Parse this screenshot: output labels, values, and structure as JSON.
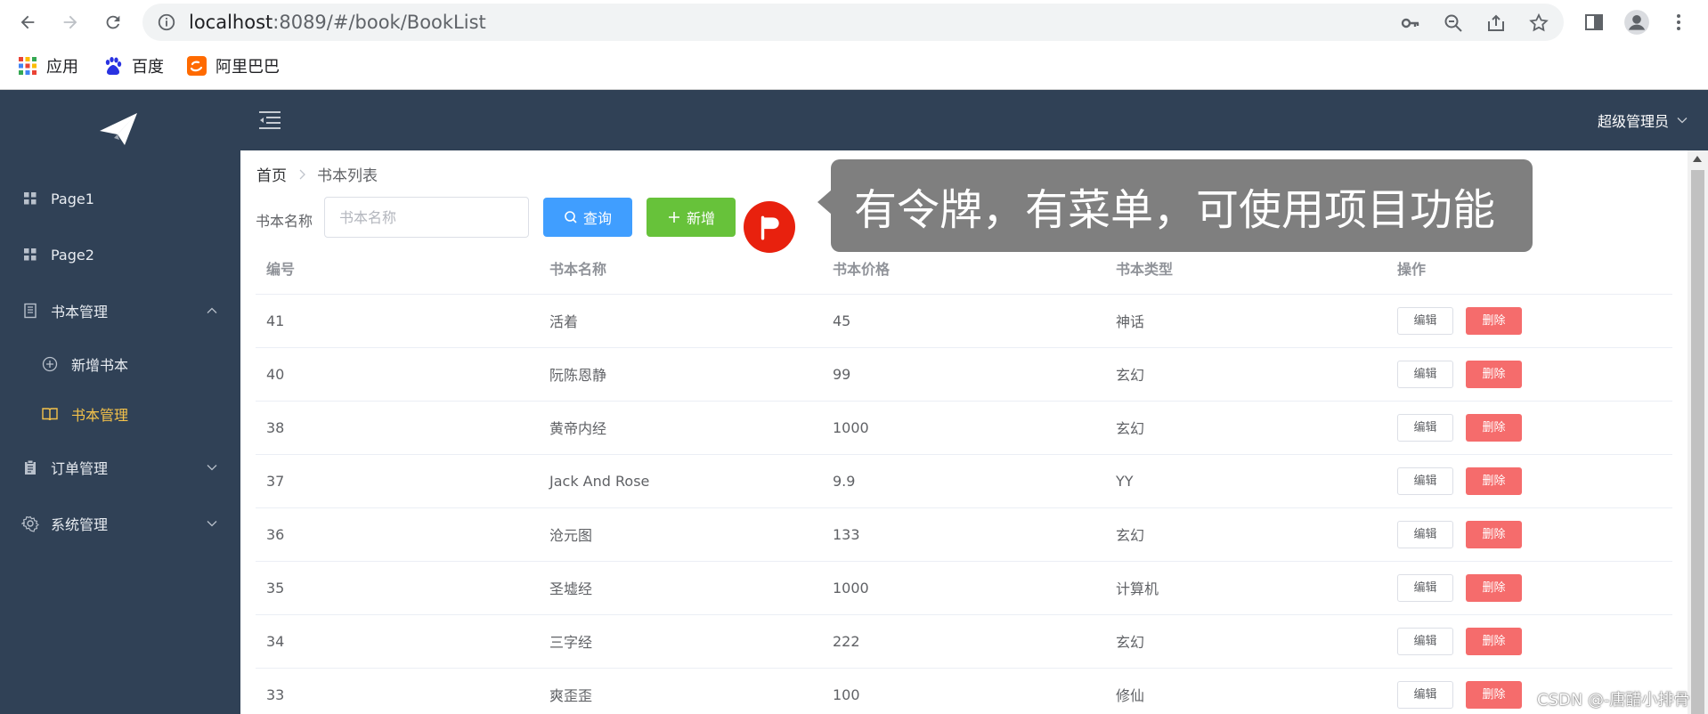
{
  "browser": {
    "url_host": "localhost",
    "url_rest": ":8089/#/book/BookList",
    "bookmarks": [
      {
        "label": "应用",
        "icon": "apps-grid-icon"
      },
      {
        "label": "百度",
        "icon": "baidu-icon"
      },
      {
        "label": "阿里巴巴",
        "icon": "alibaba-icon"
      }
    ]
  },
  "sidebar": {
    "logo": "paper-plane-icon",
    "items": [
      {
        "label": "Page1",
        "icon": "grid-icon"
      },
      {
        "label": "Page2",
        "icon": "grid-icon"
      },
      {
        "label": "书本管理",
        "icon": "document-icon",
        "expanded": true
      },
      {
        "label": "订单管理",
        "icon": "clipboard-icon",
        "expanded": false
      },
      {
        "label": "系统管理",
        "icon": "gear-icon",
        "expanded": false
      }
    ],
    "submenu": [
      {
        "label": "新增书本",
        "icon": "circle-plus-icon",
        "active": false
      },
      {
        "label": "书本管理",
        "icon": "book-icon",
        "active": true
      }
    ],
    "active_color": "#f4c24a",
    "background": "#304156"
  },
  "header": {
    "user": "超级管理员"
  },
  "breadcrumb": {
    "home": "首页",
    "current": "书本列表"
  },
  "search": {
    "label": "书本名称",
    "placeholder": "书本名称",
    "value": "",
    "query_label": "查询",
    "add_label": "新增"
  },
  "tooltip": {
    "text": "有令牌，有菜单，可使用项目功能"
  },
  "table": {
    "headers": [
      "编号",
      "书本名称",
      "书本价格",
      "书本类型",
      "操作"
    ],
    "edit_label": "编辑",
    "delete_label": "删除",
    "rows": [
      {
        "id": "41",
        "name": "活着",
        "price": "45",
        "type": "神话"
      },
      {
        "id": "40",
        "name": "阮陈恩静",
        "price": "99",
        "type": "玄幻"
      },
      {
        "id": "38",
        "name": "黄帝内经",
        "price": "1000",
        "type": "玄幻"
      },
      {
        "id": "37",
        "name": "Jack And Rose",
        "price": "9.9",
        "type": "YY"
      },
      {
        "id": "36",
        "name": "沧元图",
        "price": "133",
        "type": "玄幻"
      },
      {
        "id": "35",
        "name": "圣墟经",
        "price": "1000",
        "type": "计算机"
      },
      {
        "id": "34",
        "name": "三字经",
        "price": "222",
        "type": "玄幻"
      },
      {
        "id": "33",
        "name": "爽歪歪",
        "price": "100",
        "type": "修仙"
      }
    ]
  },
  "watermark": "CSDN @-唐醋小排骨",
  "colors": {
    "primary": "#409eff",
    "success": "#67c23a",
    "danger": "#f56c6c",
    "flag": "#e8210e"
  }
}
